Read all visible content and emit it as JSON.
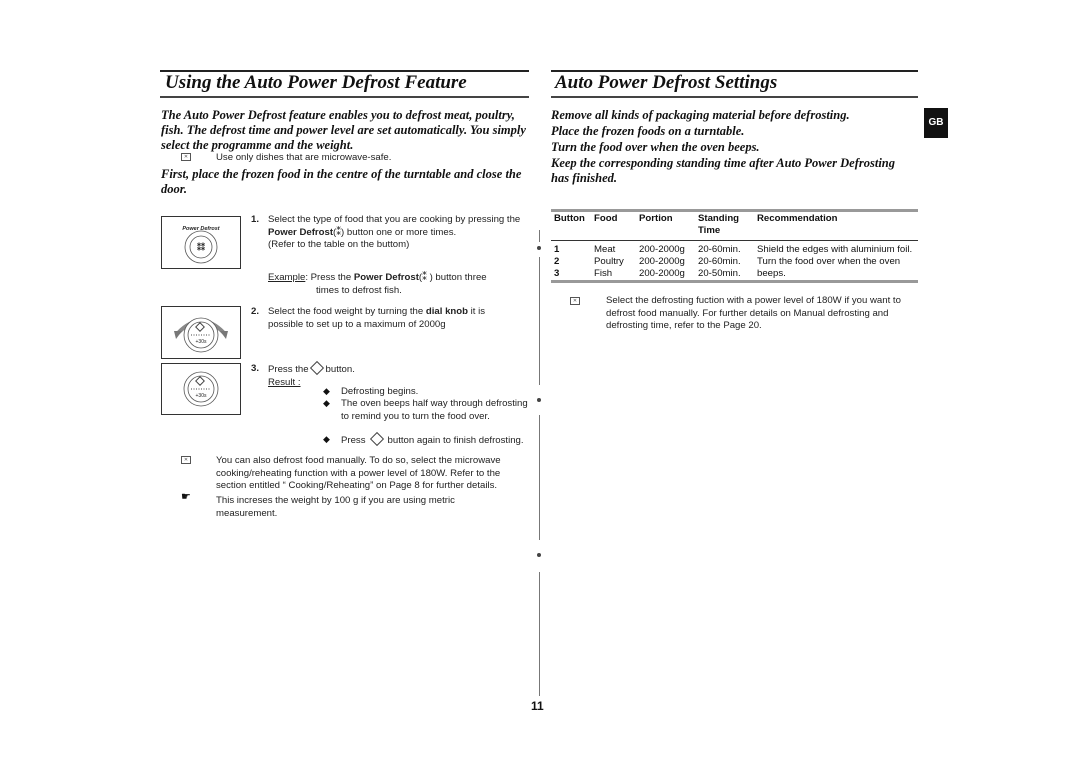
{
  "page_number": "11",
  "language_tab": "GB",
  "left": {
    "title": "Using the Auto Power Defrost Feature",
    "intro": "The Auto Power Defrost feature enables you to defrost meat, poultry, fish. The defrost time and power level are set automatically. You simply select the programme and the weight.",
    "note_dishes": "Use only dishes that are microwave-safe.",
    "intro2": "First, place the frozen food in the centre of the turntable and close the door.",
    "panel_power_defrost_label": "Power Defrost",
    "panel_dial_label": "+30s",
    "steps": [
      {
        "number": "1.",
        "text_a": "Select the type of food that you are cooking by pressing the ",
        "bold": "Power Defrost",
        "text_b": "(⁑) button one or more times.",
        "text_c": "(Refer to the table on the buttom)",
        "example_label": "Example",
        "example_a": ": Press the ",
        "example_bold": "Power Defrost",
        "example_b": "(⁑ ) button three",
        "example_c": "times to defrost fish."
      },
      {
        "number": "2.",
        "text_a": "Select the food weight by turning the ",
        "bold": "dial knob",
        "text_b": " it is possible to set up to a maximum of 2000g"
      },
      {
        "number": "3.",
        "text_a": "Press the",
        "text_b": "button.",
        "result_label": "Result :",
        "results": [
          "Defrosting begins.",
          "The oven beeps half way through defrosting to remind you to turn the food over.",
          "button again to finish defrosting."
        ],
        "result3_prefix": "Press"
      }
    ],
    "note_manual": "You can also defrost food manually. To do so, select the microwave cooking/reheating function with a power level of 180W. Refer to the section entitled “ Cooking/Reheating” on Page 8 for further details.",
    "tip_weight": "This increses the weight by 100 g if you are using metric measurement."
  },
  "right": {
    "title": "Auto Power Defrost Settings",
    "instructions": [
      "Remove all kinds of packaging material before defrosting.",
      "Place the frozen foods on a turntable.",
      "Turn the food over when the oven beeps.",
      "Keep the corresponding standing time after Auto Power Defrosting has finished."
    ],
    "table": {
      "headers": [
        "Button",
        "Food",
        "Portion",
        "Standing Time",
        "Recommendation"
      ],
      "rows": [
        {
          "button": "1",
          "food": "Meat",
          "portion": "200-2000g",
          "time": "20-60min.",
          "rec": "Shield the edges with aluminium foil."
        },
        {
          "button": "2",
          "food": "Poultry",
          "portion": "200-2000g",
          "time": "20-60min.",
          "rec": "Turn the food over when the oven"
        },
        {
          "button": "3",
          "food": "Fish",
          "portion": "200-2000g",
          "time": "20-50min.",
          "rec": "beeps."
        }
      ]
    },
    "note": "Select the defrosting fuction with a power level of 180W if you want to defrost food manually. For further details on Manual defrosting and defrosting time, refer to the Page 20."
  }
}
